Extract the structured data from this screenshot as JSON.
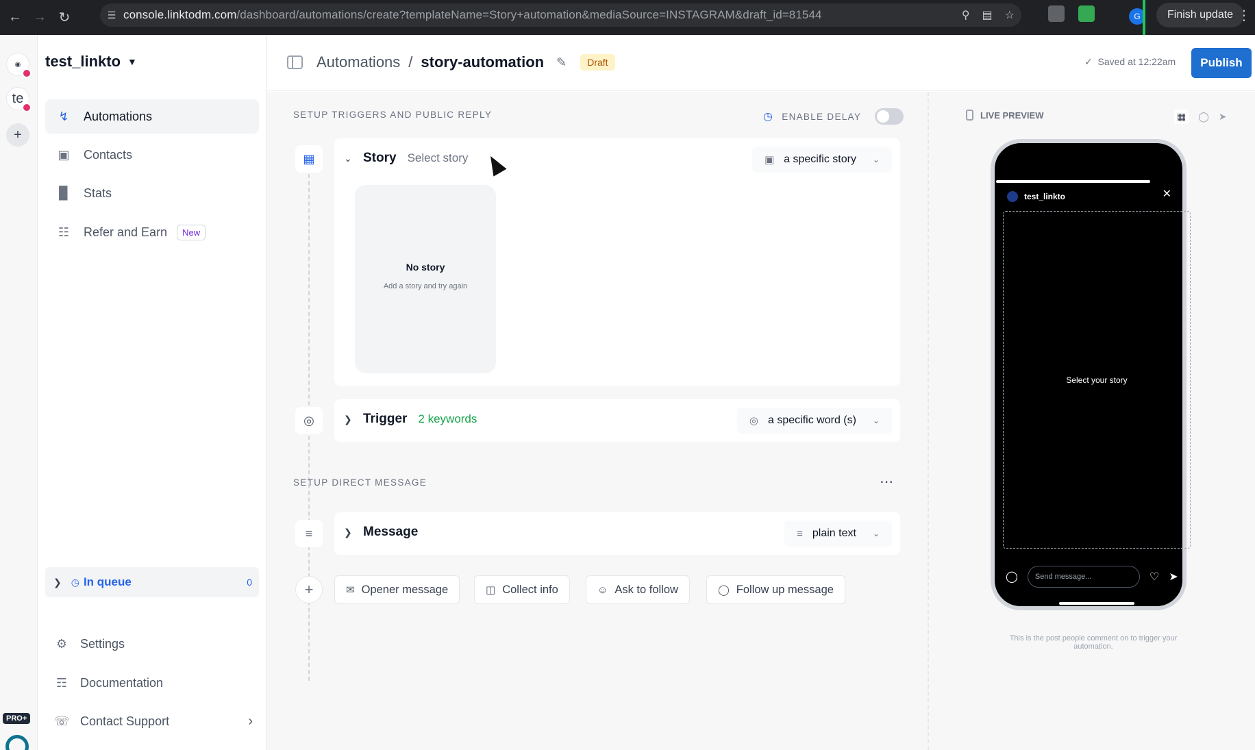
{
  "browser": {
    "url_host": "console.linktodm.com",
    "url_path": "/dashboard/automations/create?templateName=Story+automation&mediaSource=INSTAGRAM&draft_id=81544",
    "profile_initial": "G",
    "finish_update_label": "Finish update"
  },
  "rail": {
    "account_initials": "te",
    "pro_badge": "PRO+"
  },
  "sidebar": {
    "account_name": "test_linkto",
    "items": [
      {
        "label": "Automations",
        "icon": "automation-bolt-icon"
      },
      {
        "label": "Contacts",
        "icon": "contact-card-icon"
      },
      {
        "label": "Stats",
        "icon": "bar-chart-icon"
      },
      {
        "label": "Refer and Earn",
        "icon": "gift-icon",
        "badge": "New"
      }
    ],
    "queue": {
      "label": "In queue",
      "count": "0"
    },
    "footer": [
      {
        "label": "Settings",
        "icon": "gear-icon"
      },
      {
        "label": "Documentation",
        "icon": "book-icon"
      },
      {
        "label": "Contact Support",
        "icon": "support-chat-icon"
      }
    ]
  },
  "header": {
    "breadcrumb_root": "Automations",
    "breadcrumb_separator": "/",
    "breadcrumb_current": "story-automation",
    "status_badge": "Draft",
    "saved_text": "Saved at 12:22am",
    "publish_label": "Publish"
  },
  "main": {
    "section_triggers_title": "SETUP TRIGGERS AND PUBLIC REPLY",
    "enable_delay_label": "ENABLE DELAY",
    "enable_delay_on": false,
    "story_card": {
      "title": "Story",
      "subtitle": "Select story",
      "dropdown_value": "a specific story",
      "empty_title": "No story",
      "empty_hint": "Add a story and try again"
    },
    "trigger_card": {
      "title": "Trigger",
      "subtitle": "2 keywords",
      "dropdown_value": "a specific word (s)"
    },
    "section_dm_title": "SETUP DIRECT MESSAGE",
    "message_card": {
      "title": "Message",
      "dropdown_value": "plain text"
    },
    "add_chips": [
      {
        "label": "Opener message",
        "icon": "mail-icon"
      },
      {
        "label": "Collect info",
        "icon": "inbox-icon"
      },
      {
        "label": "Ask to follow",
        "icon": "user-follow-icon"
      },
      {
        "label": "Follow up message",
        "icon": "chat-bubble-icon"
      }
    ]
  },
  "preview": {
    "title": "LIVE PREVIEW",
    "story_username": "test_linkto",
    "story_placeholder": "Select your story",
    "send_placeholder": "Send message...",
    "caption": "This is the post people comment on to trigger your automation."
  },
  "colors": {
    "brand_blue": "#1e6fd0",
    "draft_bg": "#fef3c7",
    "draft_text": "#b45309",
    "keyword_green": "#16a34a"
  }
}
